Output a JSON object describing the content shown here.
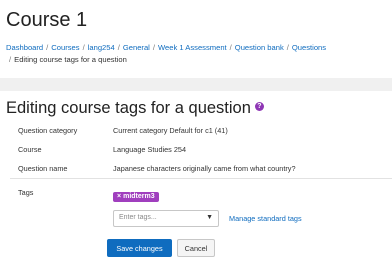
{
  "header": {
    "course_title": "Course 1",
    "breadcrumb": [
      "Dashboard",
      "Courses",
      "lang254",
      "General",
      "Week 1 Assessment",
      "Question bank",
      "Questions",
      "Editing course tags for a question"
    ]
  },
  "main": {
    "heading": "Editing course tags for a question",
    "help_icon_text": "?",
    "fields": [
      {
        "label": "Question category",
        "value": "Current category Default for c1 (41)"
      },
      {
        "label": "Course",
        "value": "Language Studies 254"
      },
      {
        "label": "Question name",
        "value": "Japanese characters originally came from what country?"
      }
    ],
    "tags": {
      "label": "Tags",
      "selected": [
        "midterm3"
      ],
      "remove_glyph": "×",
      "input_placeholder": "Enter tags...",
      "dropdown_glyph": "▼",
      "manage_link": "Manage standard tags"
    },
    "buttons": {
      "save": "Save changes",
      "cancel": "Cancel"
    }
  },
  "colors": {
    "accent": "#0f6cbf",
    "tag": "#a03fbe",
    "help_icon": "#8f37b5"
  }
}
